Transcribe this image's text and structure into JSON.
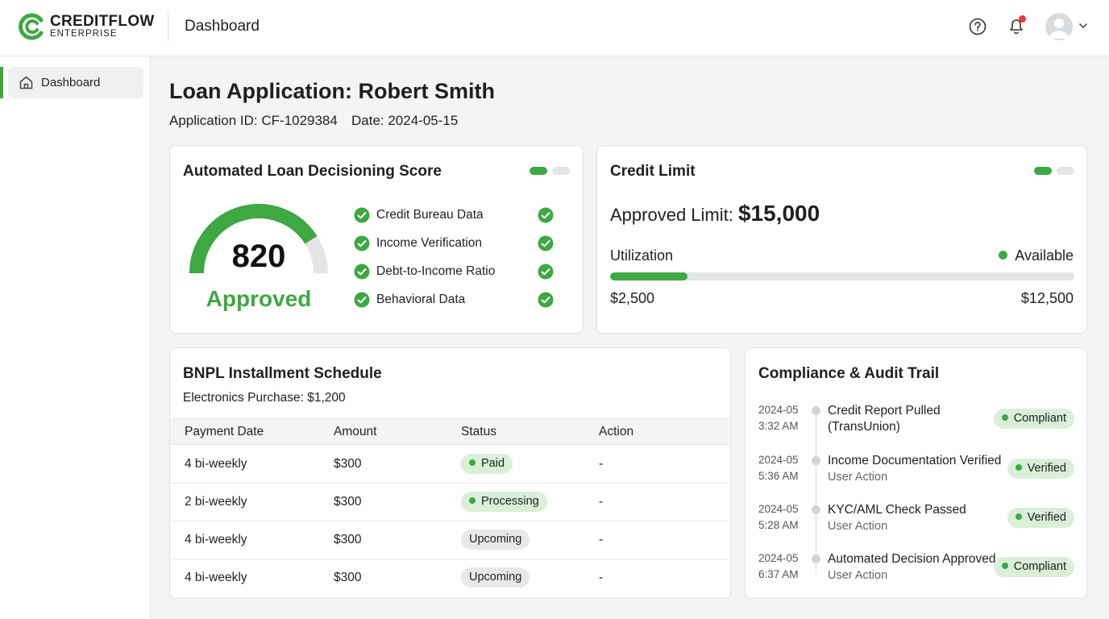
{
  "brand": {
    "name": "CREDITFLOW",
    "sub": "ENTERPRISE",
    "accent": "#3ea843"
  },
  "header": {
    "title": "Dashboard"
  },
  "sidebar": {
    "items": [
      {
        "label": "Dashboard",
        "icon": "home-icon"
      }
    ]
  },
  "application": {
    "title": "Loan Application: Robert Smith",
    "id_text": "Application ID: CF-1029384",
    "date_text": "Date: 2024-05-15"
  },
  "score_card": {
    "title": "Automated Loan Decisioning Score",
    "score": "820",
    "decision": "Approved",
    "gauge_fill": 0.82,
    "checks": [
      {
        "label": "Credit Bureau Data"
      },
      {
        "label": "Income Verification"
      },
      {
        "label": "Debt-to-Income Ratio"
      },
      {
        "label": "Behavioral Data"
      }
    ]
  },
  "credit_limit": {
    "title": "Credit Limit",
    "approved_label": "Approved Limit: ",
    "approved_value": "$15,000",
    "utilization_label": "Utilization",
    "available_label": "Available",
    "used_value": "$2,500",
    "available_value": "$12,500",
    "utilization_fraction": 0.1667
  },
  "bnpl": {
    "title": "BNPL Installment Schedule",
    "subtitle": "Electronics Purchase: $1,200",
    "columns": [
      "Payment Date",
      "Amount",
      "Status",
      "Action"
    ],
    "rows": [
      {
        "date": "4 bi-weekly",
        "amount": "$300",
        "status": "Paid",
        "status_type": "green",
        "action": "-"
      },
      {
        "date": "2 bi-weekly",
        "amount": "$300",
        "status": "Processing",
        "status_type": "green",
        "action": "-"
      },
      {
        "date": "4 bi-weekly",
        "amount": "$300",
        "status": "Upcoming",
        "status_type": "gray",
        "action": "-"
      },
      {
        "date": "4 bi-weekly",
        "amount": "$300",
        "status": "Upcoming",
        "status_type": "gray",
        "action": "-"
      }
    ]
  },
  "audit": {
    "title": "Compliance & Audit Trail",
    "items": [
      {
        "date": "2024-05",
        "time": "3:32 AM",
        "title": "Credit Report Pulled",
        "sub": "(TransUnion)",
        "badge": "Compliant"
      },
      {
        "date": "2024-05",
        "time": "5:36 AM",
        "title": "Income Documentation Verified",
        "sub": "User Action",
        "badge": "Verified"
      },
      {
        "date": "2024-05",
        "time": "5:28 AM",
        "title": "KYC/AML Check Passed",
        "sub": "User Action",
        "badge": "Verified"
      },
      {
        "date": "2024-05",
        "time": "6:37 AM",
        "title": "Automated Decision Approved",
        "sub": "User Action",
        "badge": "Compliant"
      }
    ]
  }
}
